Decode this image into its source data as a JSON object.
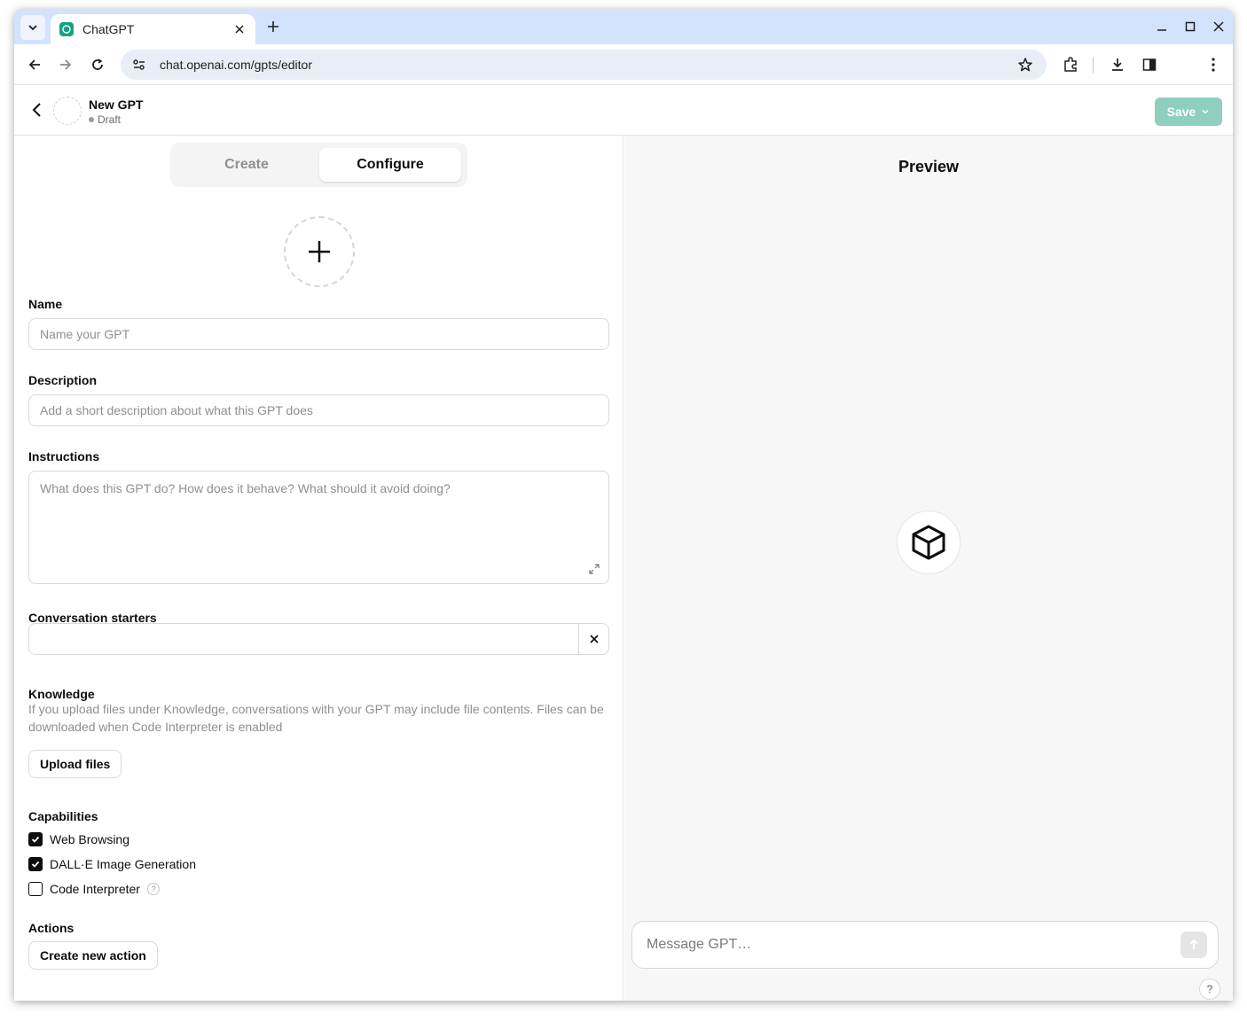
{
  "browser": {
    "tab_title": "ChatGPT",
    "url": "chat.openai.com/gpts/editor",
    "icons": [
      "tab-search-icon",
      "chatgpt-favicon-icon",
      "close-icon",
      "plus-icon",
      "minimize-icon",
      "maximize-icon",
      "window-close-icon",
      "back-arrow-icon",
      "forward-arrow-icon",
      "reload-icon",
      "site-settings-icon",
      "star-icon",
      "extensions-icon",
      "download-icon",
      "side-panel-icon",
      "more-vertical-icon"
    ]
  },
  "header": {
    "gpt_name": "New GPT",
    "status": "Draft",
    "save_label": "Save"
  },
  "tabs": {
    "create": "Create",
    "configure": "Configure",
    "active": "Configure"
  },
  "form": {
    "name_label": "Name",
    "name_placeholder": "Name your GPT",
    "name_value": "",
    "description_label": "Description",
    "description_placeholder": "Add a short description about what this GPT does",
    "description_value": "",
    "instructions_label": "Instructions",
    "instructions_placeholder": "What does this GPT do? How does it behave? What should it avoid doing?",
    "instructions_value": "",
    "starters_label": "Conversation starters",
    "starter_value": "",
    "knowledge_label": "Knowledge",
    "knowledge_help": "If you upload files under Knowledge, conversations with your GPT may include file contents. Files can be downloaded when Code Interpreter is enabled",
    "upload_label": "Upload files",
    "capabilities_label": "Capabilities",
    "capabilities": [
      {
        "label": "Web Browsing",
        "checked": true
      },
      {
        "label": "DALL·E Image Generation",
        "checked": true
      },
      {
        "label": "Code Interpreter",
        "checked": false
      }
    ],
    "actions_label": "Actions",
    "create_action_label": "Create new action"
  },
  "preview": {
    "title": "Preview",
    "message_placeholder": "Message GPT…",
    "help_label": "?"
  },
  "colors": {
    "save_button": "#8ecfbf",
    "tab_strip": "#d3e3fd",
    "preview_bg": "#f7f7f7"
  }
}
